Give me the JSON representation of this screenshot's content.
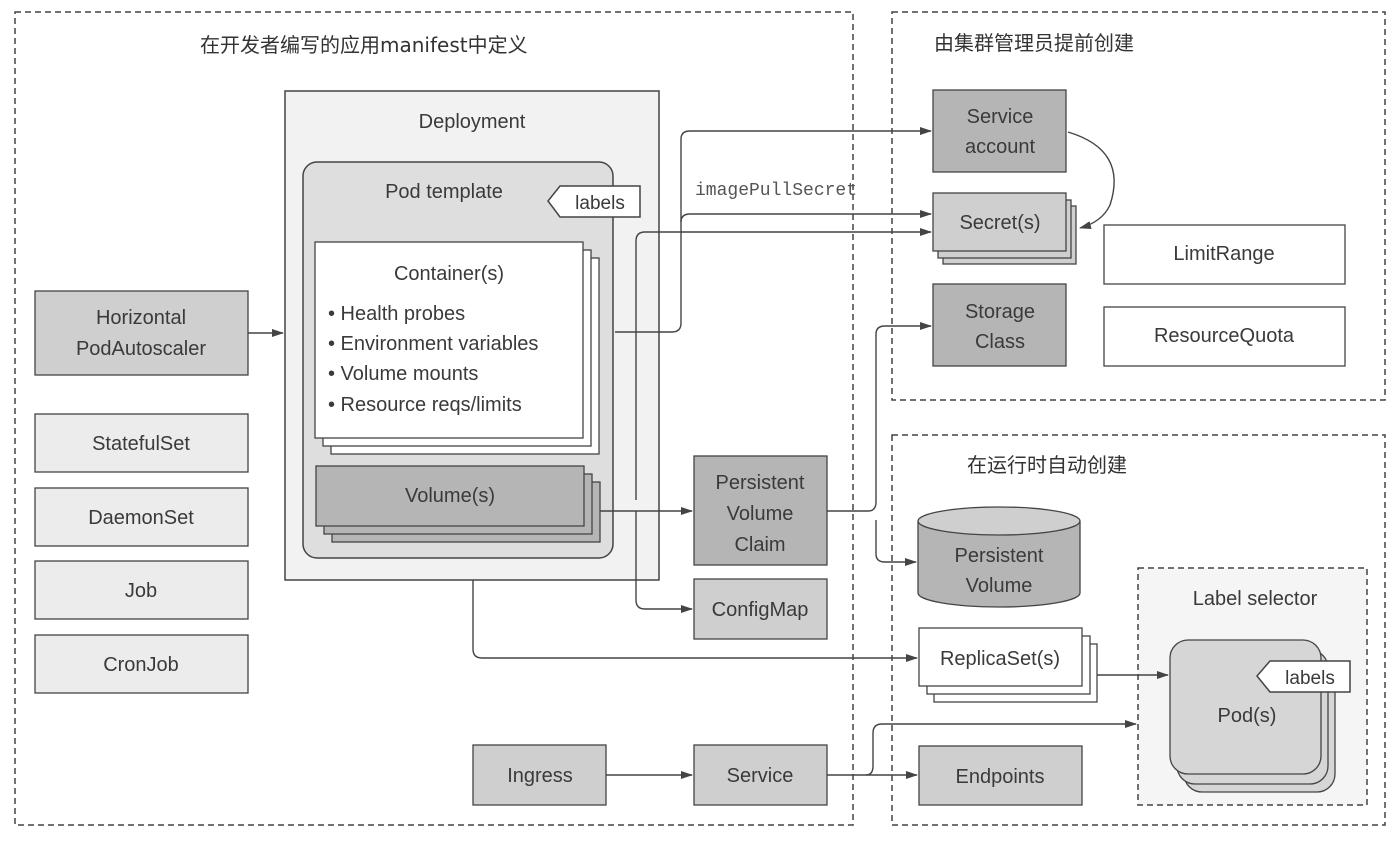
{
  "regions": {
    "developer": "在开发者编写的应用manifest中定义",
    "admin": "由集群管理员提前创建",
    "runtime": "在运行时自动创建"
  },
  "deployment": {
    "title": "Deployment",
    "pod_template": "Pod template",
    "labels": "labels",
    "container_title": "Container(s)",
    "container_items": [
      "• Health probes",
      "• Environment variables",
      "• Volume mounts",
      "• Resource reqs/limits"
    ],
    "volumes": "Volume(s)"
  },
  "left_column": {
    "hpa_line1": "Horizontal",
    "hpa_line2": "PodAutoscaler",
    "workloads": [
      "StatefulSet",
      "DaemonSet",
      "Job",
      "CronJob"
    ]
  },
  "middle": {
    "pvc": [
      "Persistent",
      "Volume",
      "Claim"
    ],
    "configmap": "ConfigMap",
    "ingress": "Ingress",
    "service": "Service",
    "image_pull_secret": "imagePullSecret"
  },
  "admin_objects": {
    "service_account": [
      "Service",
      "account"
    ],
    "secrets": "Secret(s)",
    "storage_class": [
      "Storage",
      "Class"
    ],
    "limit_range": "LimitRange",
    "resource_quota": "ResourceQuota"
  },
  "runtime_objects": {
    "persistent_volume": [
      "Persistent",
      "Volume"
    ],
    "replicasets": "ReplicaSet(s)",
    "endpoints": "Endpoints",
    "label_selector": "Label selector",
    "pods": "Pod(s)",
    "pod_labels": "labels"
  },
  "colors": {
    "dark_box": "#b9b9b9",
    "mid_box": "#d2d2d2",
    "light_box": "#ebebeb",
    "white_box": "#ffffff",
    "line": "#444444"
  }
}
